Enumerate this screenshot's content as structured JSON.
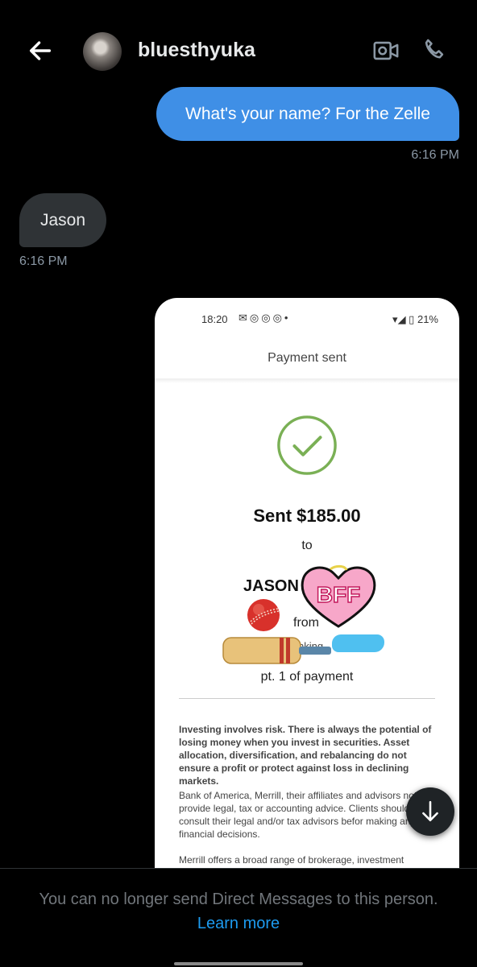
{
  "header": {
    "username": "bluesthyuka",
    "back_icon": "arrow-left-icon",
    "video_icon": "video-camera-icon",
    "phone_icon": "phone-icon"
  },
  "messages": [
    {
      "direction": "outgoing",
      "text": "What's your name? For the Zelle",
      "time": "6:16 PM"
    },
    {
      "direction": "incoming",
      "text": "Jason",
      "time": "6:16 PM"
    }
  ],
  "attachment": {
    "status_time": "18:20",
    "status_battery": "21%",
    "page_title": "Payment sent",
    "sent_amount": "Sent $185.00",
    "to_label": "to",
    "recipient": "JASON",
    "from_label": "from",
    "from_masked": "nking",
    "note": "pt. 1 of payment",
    "disclaimer_1": "Investing involves risk. There is always the potential of losing money when you invest in securities. Asset allocation, diversification, and rebalancing do not ensure a profit or protect against loss in declining markets.",
    "disclaimer_2": "Bank of America, Merrill, their affiliates and advisors not provide legal, tax or accounting advice. Clients should consult their legal and/or tax advisors befor making any financial decisions.",
    "disclaimer_3": "Merrill offers a broad range of brokerage, investment",
    "sticker_text": "BFF"
  },
  "footer": {
    "notice": "You can no longer send Direct Messages to this person.",
    "learn_more": "Learn more"
  },
  "colors": {
    "outgoing_bubble": "#3f8fe6",
    "incoming_bubble": "#2f3336",
    "link": "#1d9bf0",
    "check": "#7ab055"
  }
}
